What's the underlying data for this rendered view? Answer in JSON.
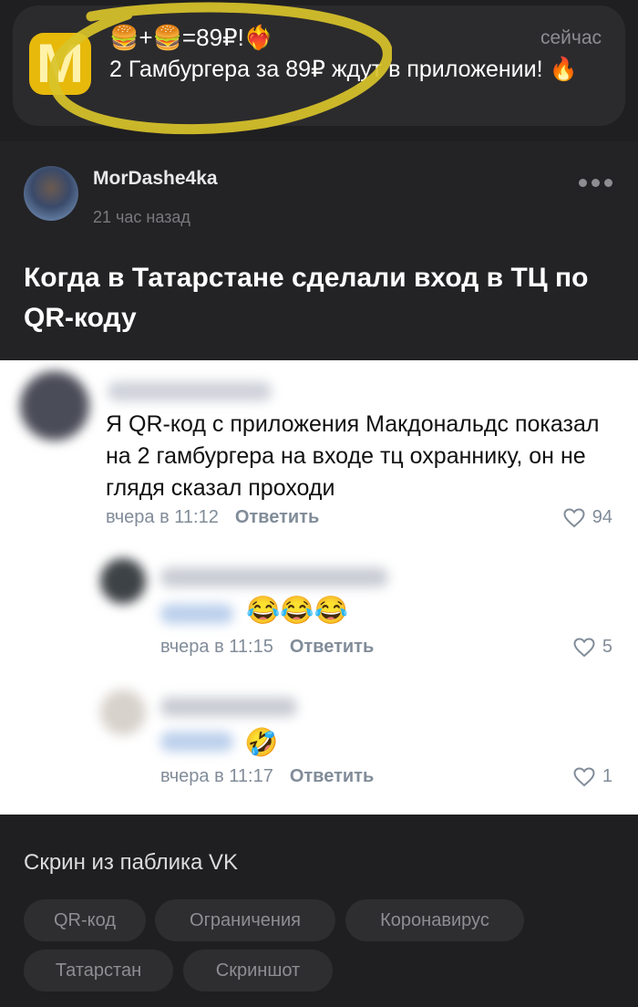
{
  "notification": {
    "icon": "mcdonalds-logo-icon",
    "title": "🍔+🍔=89₽!❤️‍🔥",
    "time": "сейчас",
    "body": "2 Гамбургера за 89₽ ждут в приложении! 🔥",
    "highlight_color": "#d9c32a"
  },
  "post": {
    "author": "MorDashe4ka",
    "time": "21 час назад",
    "title": "Когда в Татарстане сделали вход в ТЦ по QR-коду"
  },
  "screenshot": {
    "comment": {
      "text": "Я QR-код с приложения Макдональдс показал на 2 гамбургера на входе тц охраннику, он не глядя сказал проходи",
      "time": "вчера в 11:12",
      "reply": "Ответить",
      "likes": "94"
    },
    "reply1": {
      "emoji": "😂😂😂",
      "time": "вчера в 11:15",
      "reply": "Ответить",
      "likes": "5"
    },
    "reply2": {
      "emoji": "🤣",
      "time": "вчера в 11:17",
      "reply": "Ответить",
      "likes": "1"
    }
  },
  "caption": "Скрин из паблика VK",
  "tags": [
    "QR-код",
    "Ограничения",
    "Коронавирус",
    "Татарстан",
    "Скриншот"
  ]
}
